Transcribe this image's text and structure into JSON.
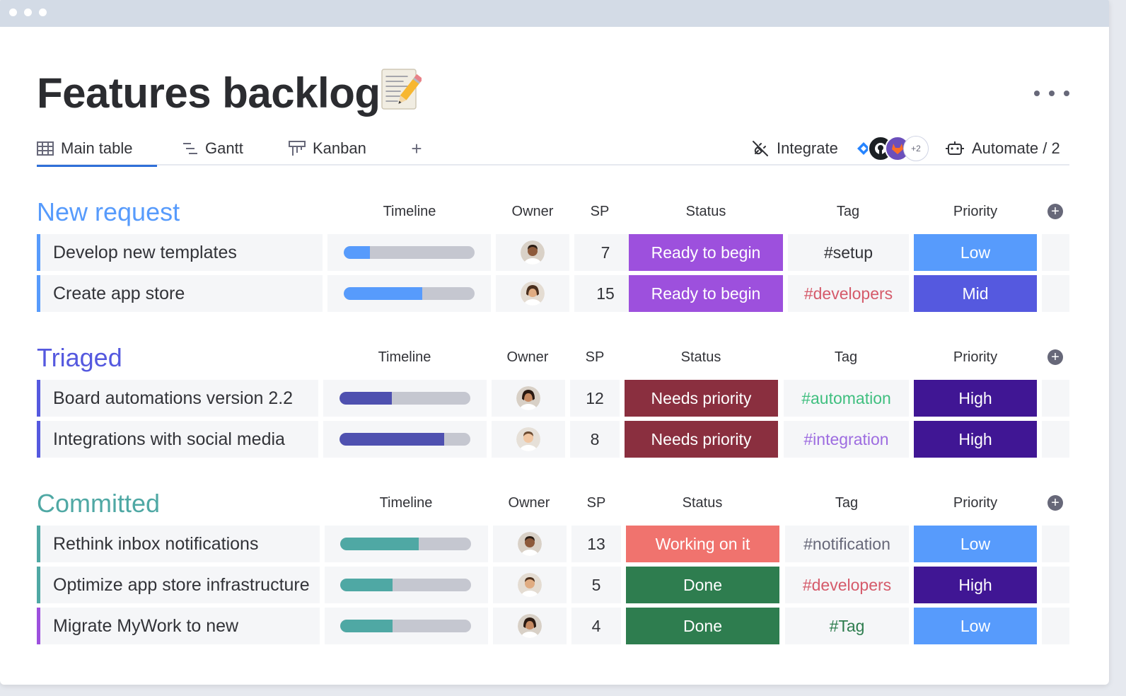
{
  "board": {
    "title": "Features backlog",
    "title_emoji": "memo-pencil-icon"
  },
  "view_tabs": [
    {
      "label": "Main table",
      "icon": "table-icon",
      "active": true
    },
    {
      "label": "Gantt",
      "icon": "gantt-icon",
      "active": false
    },
    {
      "label": "Kanban",
      "icon": "kanban-icon",
      "active": false
    }
  ],
  "add_view_label": "+",
  "toolbar": {
    "integrate_label": "Integrate",
    "integrations_more": "+2",
    "automate_label": "Automate / 2"
  },
  "columns": {
    "timeline": "Timeline",
    "owner": "Owner",
    "sp": "SP",
    "status": "Status",
    "tag": "Tag",
    "priority": "Priority"
  },
  "colors": {
    "ready_to_begin": "#9d50dd",
    "needs_priority": "#8a2f3f",
    "working_on_it": "#f0736e",
    "done": "#2e7d4f",
    "low": "#579bfc",
    "mid": "#5559df",
    "high": "#401694"
  },
  "groups": [
    {
      "title": "New request",
      "color": "#579bfc",
      "rows": [
        {
          "name": "Develop new templates",
          "timeline_progress": 0.2,
          "timeline_color": "#579bfc",
          "owner_avatar": "man-avatar",
          "sp": "7",
          "status": "Ready to begin",
          "status_color": "#9d50dd",
          "tag": "#setup",
          "tag_color": "#323338",
          "priority": "Low",
          "priority_color": "#579bfc"
        },
        {
          "name": "Create app store",
          "timeline_progress": 0.6,
          "timeline_color": "#579bfc",
          "owner_avatar": "woman-avatar",
          "sp": "15",
          "status": "Ready to begin",
          "status_color": "#9d50dd",
          "tag": "#developers",
          "tag_color": "#d55a6a",
          "priority": "Mid",
          "priority_color": "#5559df"
        }
      ]
    },
    {
      "title": "Triaged",
      "color": "#5559df",
      "rows": [
        {
          "name": "Board automations version 2.2",
          "timeline_progress": 0.4,
          "timeline_color": "#4f51b0",
          "owner_avatar": "woman-avatar",
          "sp": "12",
          "status": "Needs priority",
          "status_color": "#8a2f3f",
          "tag": "#automation",
          "tag_color": "#3fbf7f",
          "priority": "High",
          "priority_color": "#401694"
        },
        {
          "name": "Integrations with social media",
          "timeline_progress": 0.8,
          "timeline_color": "#4f51b0",
          "owner_avatar": "man-avatar",
          "sp": "8",
          "status": "Needs priority",
          "status_color": "#8a2f3f",
          "tag": "#integration",
          "tag_color": "#9d6ce0",
          "priority": "High",
          "priority_color": "#401694"
        }
      ]
    },
    {
      "title": "Committed",
      "color": "#4fa8a4",
      "rows": [
        {
          "name": "Rethink inbox notifications",
          "timeline_progress": 0.6,
          "timeline_color": "#4fa8a4",
          "owner_avatar": "man-avatar",
          "sp": "13",
          "status": "Working on it",
          "status_color": "#f0736e",
          "tag": "#notification",
          "tag_color": "#676879",
          "priority": "Low",
          "priority_color": "#579bfc"
        },
        {
          "name": "Optimize app store infrastructure",
          "timeline_progress": 0.4,
          "timeline_color": "#4fa8a4",
          "owner_avatar": "man-avatar",
          "sp": "5",
          "status": "Done",
          "status_color": "#2e7d4f",
          "tag": "#developers",
          "tag_color": "#d55a6a",
          "priority": "High",
          "priority_color": "#401694"
        },
        {
          "name": "Migrate MyWork to new",
          "timeline_progress": 0.4,
          "timeline_color": "#4fa8a4",
          "owner_avatar": "woman-avatar",
          "sp": "4",
          "status": "Done",
          "status_color": "#2e7d4f",
          "tag": "#Tag",
          "tag_color": "#2e7d4f",
          "priority": "Low",
          "priority_color": "#579bfc",
          "row_accent": "#9d50dd"
        }
      ]
    }
  ]
}
